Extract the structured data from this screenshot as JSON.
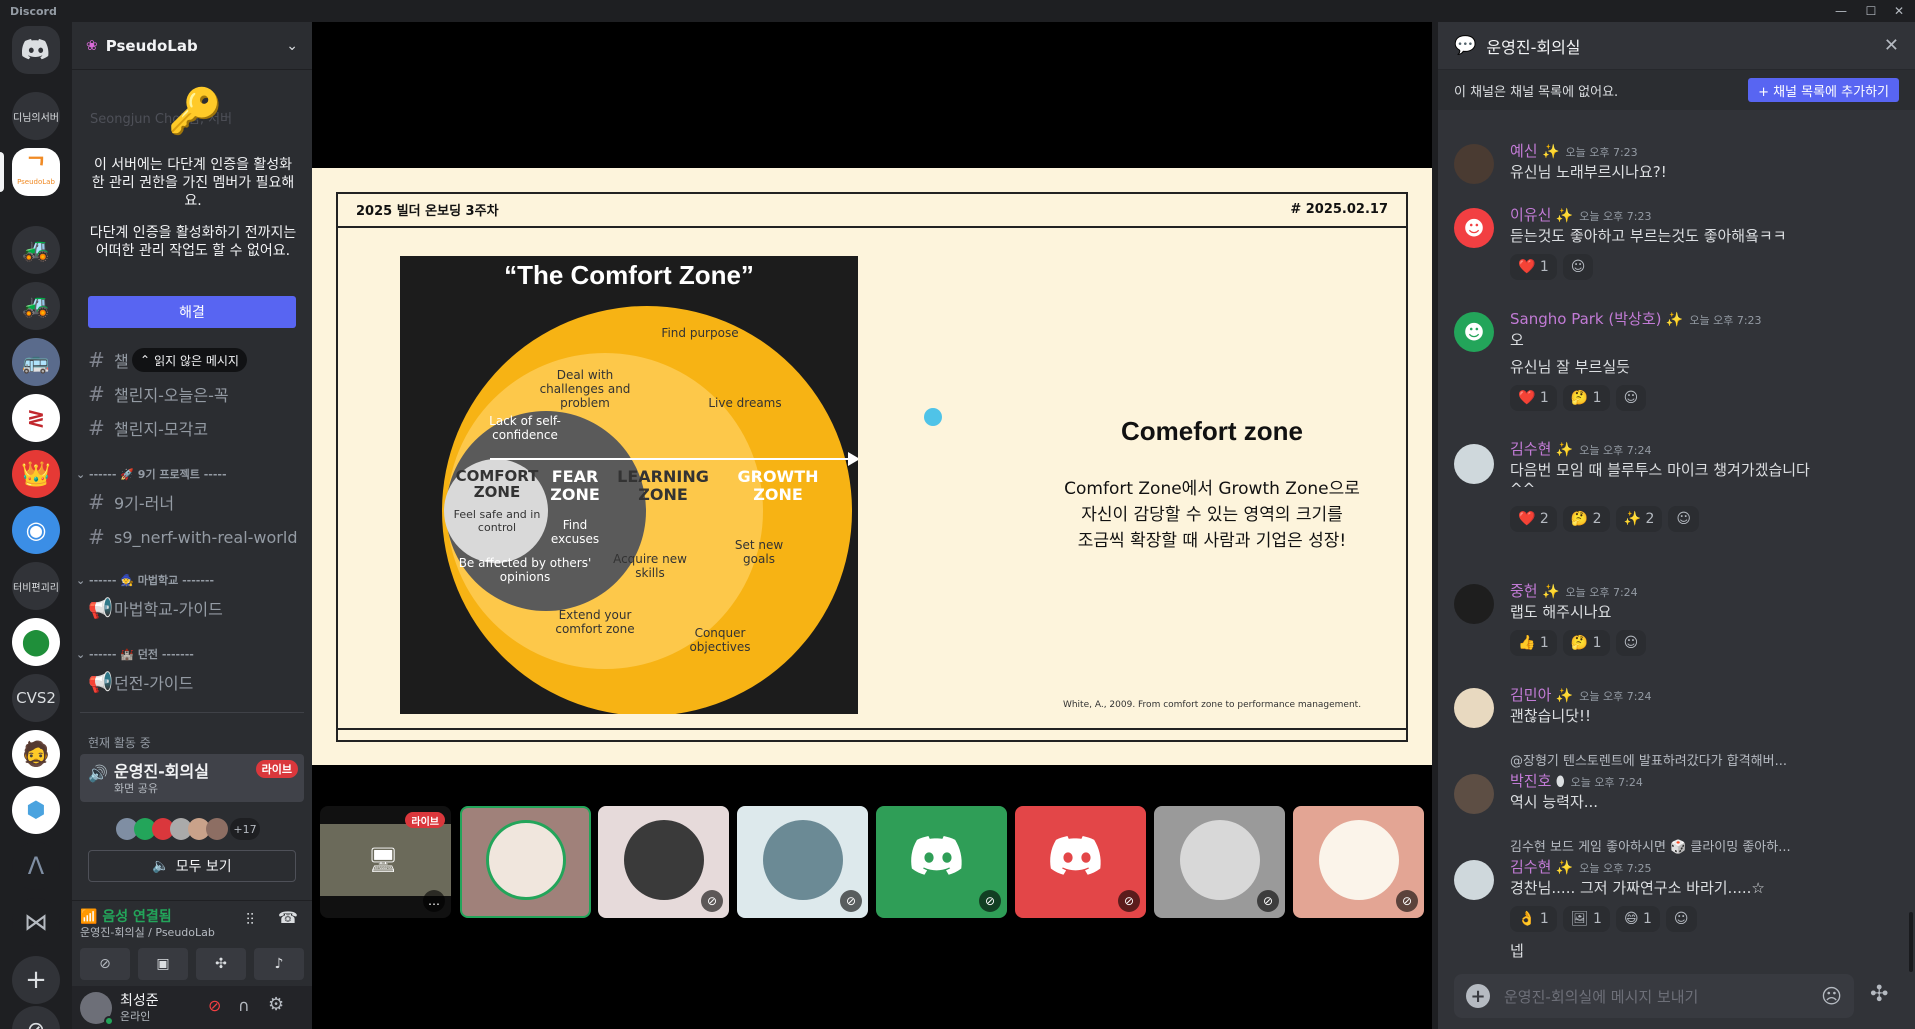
{
  "window": {
    "title": "Discord"
  },
  "rail": {
    "servers": [
      "디님의서버",
      "PseudoLab",
      "터비편괴리",
      "CVS2"
    ],
    "pseudolab_sub": "PseudoLab",
    "add_icon": "plus-icon",
    "explore_icon": "compass-icon"
  },
  "sidebar": {
    "guild_name": "PseudoLab",
    "behind_text": "Seongjun Choi 님, 서버",
    "mfa_notice_1": "이 서버에는 다단계 인증을 활성화한 관리 권한을 가진 멤버가 필요해요.",
    "mfa_notice_2": "다단계 인증을 활성화하기 전까지는 어떠한 관리 작업도 할 수 없어요.",
    "resolve_label": "해결",
    "unread_label": "읽지 않은 메시지",
    "channel_partial": "챌",
    "channels_top": [
      "챌린지-오늘은-꼭",
      "챌린지-모각코"
    ],
    "cat_9th": "------ 🚀 9기 프로젝트 -----",
    "channels_9th": [
      "9기-러너",
      "s9_nerf-with-real-world"
    ],
    "cat_magic": "------ 🧙 마법학교 -------",
    "channels_magic": [
      "마법학교-가이드"
    ],
    "cat_dungeon": "------ 🏰 던전 -------",
    "channels_dungeon": [
      "던전-가이드"
    ],
    "active_now": "현재 활동 중",
    "active_channel": "운영진-회의실",
    "active_sub": "화면 공유",
    "live_badge": "라이브",
    "more_count": "+17",
    "view_all": "모두 보기",
    "voice_status": "음성 연결됨",
    "voice_location": "운영진-회의실 / PseudoLab",
    "user_name": "최성준",
    "user_status": "온라인"
  },
  "slide": {
    "header_left": "2025 빌더 온보딩 3주차",
    "header_right": "# 2025.02.17",
    "figure_title": "“The Comfort Zone”",
    "zones": {
      "comfort": "COMFORT ZONE",
      "comfort_sub": "Feel safe and in control",
      "fear": "FEAR ZONE",
      "learning": "LEARNING ZONE",
      "growth": "GROWTH ZONE"
    },
    "notes": {
      "lack": "Lack of self-confidence",
      "find_excuses": "Find excuses",
      "affected": "Be affected by others' opinions",
      "deal": "Deal with challenges and problem",
      "find_purpose": "Find purpose",
      "live_dreams": "Live dreams",
      "acquire": "Acquire new skills",
      "new_goals": "Set new goals",
      "extend": "Extend your comfort zone",
      "conquer": "Conquer objectives"
    },
    "heading": "Comefort zone",
    "body_1": "Comfort Zone에서 Growth Zone으로",
    "body_2": "자신이 감당할 수 있는 영역의 크기를",
    "body_3": "조금씩 확장할 때 사람과 기업은 성장!",
    "citation": "White, A., 2009. From comfort zone to performance management."
  },
  "tiles": {
    "live_label": "라이브",
    "more": "…"
  },
  "chat": {
    "channel_title": "운영진-회의실",
    "not_in_list": "이 채널은 채널 목록에 없어요.",
    "add_button": "+ 채널 목록에 추가하기",
    "messages": [
      {
        "name": "예신",
        "time": "오늘 오후 7:23",
        "text": "유신님 노래부르시나요?!",
        "color": "#c27bd6"
      },
      {
        "name": "이유신",
        "time": "오늘 오후 7:23",
        "text": "듣는것도 좋아하고 부르는것도 좋아해욬ㅋㅋ",
        "color": "#c27bd6",
        "reactions": [
          "❤️ 1"
        ]
      },
      {
        "name": "Sangho Park (박상호)",
        "time": "오늘 오후 7:23",
        "text": "오",
        "text2": "유신님 잘 부르실듯",
        "color": "#c27bd6",
        "reactions": [
          "❤️ 1",
          "🤔 1"
        ]
      },
      {
        "name": "김수현",
        "time": "오늘 오후 7:24",
        "text": "다음번 모임 때 블루투스 마이크 챙겨가겠습니다",
        "text2": "^^",
        "color": "#c27bd6",
        "reactions": [
          "❤️ 2",
          "🤔 2",
          "✨ 2"
        ]
      },
      {
        "name": "중헌",
        "time": "오늘 오후 7:24",
        "text": "랩도 해주시나요",
        "color": "#c27bd6",
        "reactions": [
          "👍 1",
          "🤔 1"
        ]
      },
      {
        "name": "김민아",
        "time": "오늘 오후 7:24",
        "text": "괜찮습니닷!!",
        "color": "#c27bd6"
      },
      {
        "reply": "@장형기 텐스토렌트에 발표하려갔다가 합격해버...",
        "name": "박진호",
        "time": "오늘 오후 7:24",
        "text": "역시 능력자...",
        "color": "#c27bd6"
      },
      {
        "reply": "김수현 보드 게임 좋아하시면 🎲 클라이밍 좋아하...",
        "name": "김수현",
        "time": "오늘 오후 7:25",
        "text": "경찬님..... 그저 가짜연구소 바라기.....☆",
        "text2": "넵",
        "color": "#c27bd6",
        "reactions": [
          "👌 1",
          "🖼 1",
          "😄 1"
        ]
      }
    ],
    "input_placeholder": "운영진-회의실에 메시지 보내기"
  }
}
